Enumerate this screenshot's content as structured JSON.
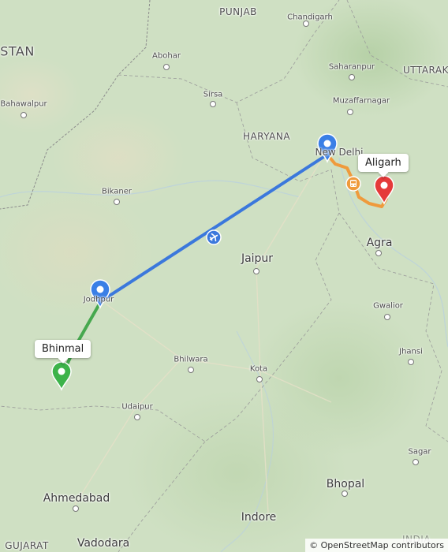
{
  "map": {
    "regions": [
      {
        "text": "STAN"
      },
      {
        "text": "PUNJAB"
      },
      {
        "text": "HARYANA"
      },
      {
        "text": "UTTARAK"
      },
      {
        "text": "GUJARAT"
      },
      {
        "text": "INDIA"
      }
    ],
    "cities": [
      {
        "text": "Chandigarh"
      },
      {
        "text": "Abohar"
      },
      {
        "text": "Saharanpur"
      },
      {
        "text": "Bahawalpur"
      },
      {
        "text": "Sirsa"
      },
      {
        "text": "Muzaffarnagar"
      },
      {
        "text": "New Delhi"
      },
      {
        "text": "Bikaner"
      },
      {
        "text": "Agra"
      },
      {
        "text": "Jaipur"
      },
      {
        "text": "Jodhpur"
      },
      {
        "text": "Gwalior"
      },
      {
        "text": "Jhansi"
      },
      {
        "text": "Bhilwara"
      },
      {
        "text": "Kota"
      },
      {
        "text": "Udaipur"
      },
      {
        "text": "Sagar"
      },
      {
        "text": "Ahmedabad"
      },
      {
        "text": "Bhopal"
      },
      {
        "text": "Indore"
      },
      {
        "text": "Vadodara"
      }
    ],
    "markers": {
      "origin": {
        "label": "Bhinmal",
        "color": "#3db34a",
        "icon": "map-pin-icon"
      },
      "waypoint1": {
        "label": "Jodhpur",
        "color": "#3a7fe6",
        "icon": "map-pin-icon"
      },
      "waypoint2": {
        "label": "New Delhi",
        "color": "#3a7fe6",
        "icon": "map-pin-icon"
      },
      "destination": {
        "label": "Aligarh",
        "color": "#e53a3a",
        "icon": "map-pin-icon"
      }
    },
    "route_legs": [
      {
        "mode": "drive",
        "from": "Bhinmal",
        "to": "Jodhpur",
        "color": "#46a84e"
      },
      {
        "mode": "flight",
        "from": "Jodhpur",
        "to": "New Delhi",
        "color": "#3b78dc",
        "icon": "airplane-icon"
      },
      {
        "mode": "bus",
        "from": "New Delhi",
        "to": "Aligarh",
        "color": "#ef9a3c",
        "icon": "bus-icon"
      }
    ],
    "attribution": "© OpenStreetMap contributors"
  }
}
